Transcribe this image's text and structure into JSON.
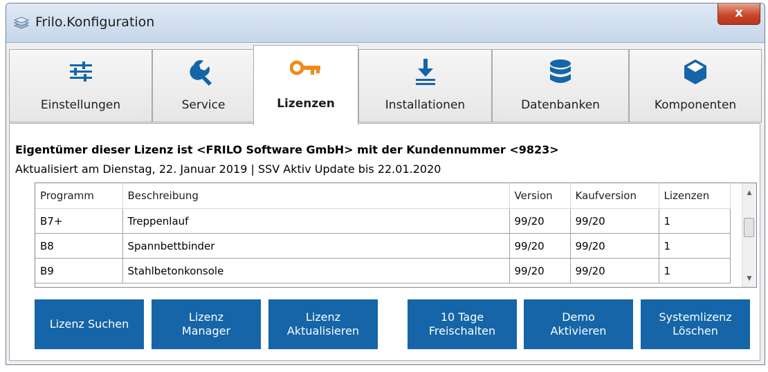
{
  "window": {
    "title": "Frilo.Konfiguration",
    "close_label": "x"
  },
  "tabs": [
    {
      "label": "Einstellungen",
      "icon": "sliders-icon"
    },
    {
      "label": "Service",
      "icon": "wrench-icon"
    },
    {
      "label": "Lizenzen",
      "icon": "key-icon",
      "active": true
    },
    {
      "label": "Installationen",
      "icon": "download-icon"
    },
    {
      "label": "Datenbanken",
      "icon": "database-icon"
    },
    {
      "label": "Komponenten",
      "icon": "cube-icon"
    }
  ],
  "license": {
    "owner_text": "Eigentümer dieser Lizenz ist <FRILO Software GmbH> mit der Kundennummer <9823>",
    "updated_text": "Aktualisiert am Dienstag, 22. Januar 2019 | SSV Aktiv Update bis 22.01.2020"
  },
  "table": {
    "headers": [
      "Programm",
      "Beschreibung",
      "Version",
      "Kaufversion",
      "Lizenzen"
    ],
    "rows": [
      [
        "B7+",
        "Treppenlauf",
        "99/20",
        "99/20",
        "1"
      ],
      [
        "B8",
        "Spannbettbinder",
        "99/20",
        "99/20",
        "1"
      ],
      [
        "B9",
        "Stahlbetonkonsole",
        "99/20",
        "99/20",
        "1"
      ]
    ]
  },
  "buttons": [
    {
      "line1": "Lizenz Suchen",
      "line2": ""
    },
    {
      "line1": "Lizenz",
      "line2": "Manager"
    },
    {
      "line1": "Lizenz",
      "line2": "Aktualisieren"
    },
    {
      "line1": "10 Tage",
      "line2": "Freischalten"
    },
    {
      "line1": "Demo",
      "line2": "Aktivieren"
    },
    {
      "line1": "Systemlizenz",
      "line2": "Löschen"
    }
  ],
  "colors": {
    "button_bg": "#1565a8",
    "key_icon": "#f08a1c",
    "tab_icons": "#1565a8",
    "close": "#c9472a"
  }
}
